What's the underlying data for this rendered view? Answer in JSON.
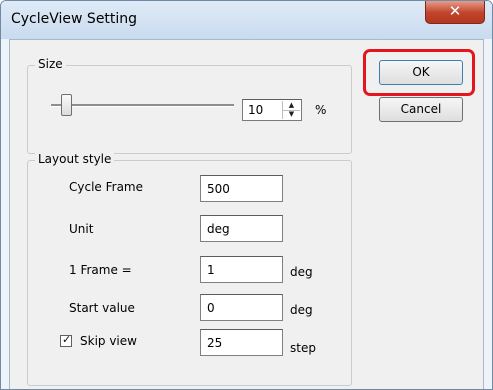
{
  "window": {
    "title": "CycleView Setting",
    "close_glyph": "✕"
  },
  "size_group": {
    "label": "Size",
    "slider_value": 10,
    "spin_value": "10",
    "unit": "%"
  },
  "layout_group": {
    "label": "Layout style",
    "cycle_frame": {
      "label": "Cycle Frame",
      "value": "500"
    },
    "unit": {
      "label": "Unit",
      "value": "deg"
    },
    "frame": {
      "label": "1 Frame  =",
      "value": "1",
      "unit": "deg"
    },
    "start_value": {
      "label": "Start value",
      "value": "0",
      "unit": "deg"
    },
    "skip_view": {
      "label": "Skip view",
      "checked": true,
      "value": "25",
      "unit": "step"
    }
  },
  "buttons": {
    "ok": "OK",
    "cancel": "Cancel"
  },
  "annotation": {
    "highlight_color": "#e5151d",
    "highlight_target": "ok-button"
  },
  "icons": {
    "spin_up": "▲",
    "spin_down": "▼",
    "check": "✓"
  }
}
